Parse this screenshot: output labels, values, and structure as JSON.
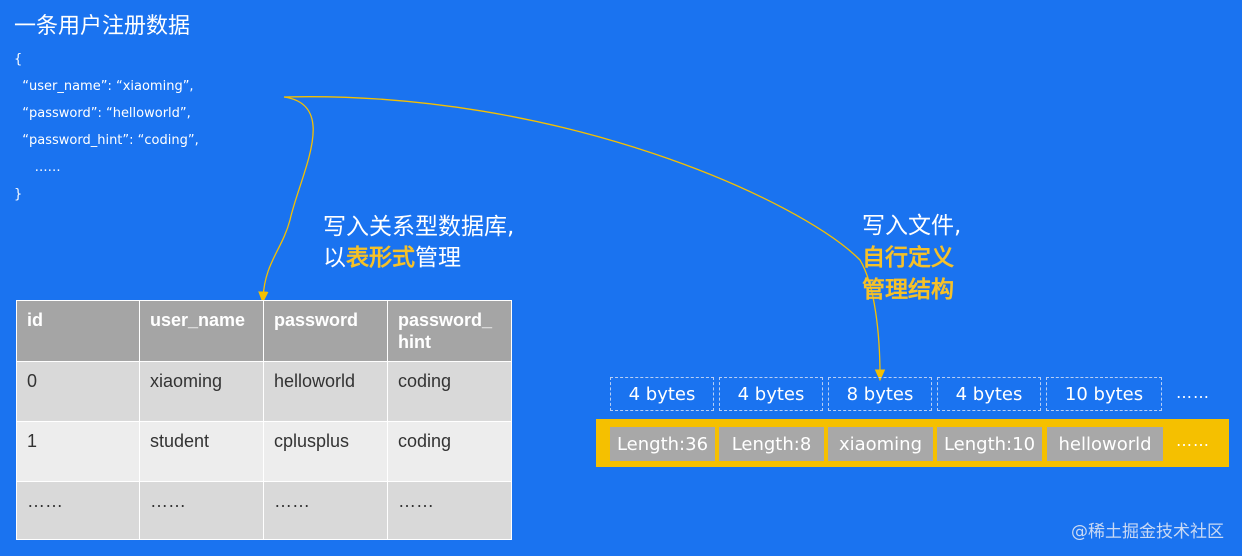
{
  "title": "一条用户注册数据",
  "json_lines": [
    "{",
    "  “user_name”: “xiaoming”,",
    "  “password”: “helloworld”,",
    "  “password_hint”: “coding”,",
    "     ……",
    "}"
  ],
  "label_db": {
    "line1": "写入关系型数据库,",
    "prefix": "以",
    "highlight": "表形式",
    "suffix": "管理"
  },
  "label_file": {
    "line1": "写入文件,",
    "highlight1": "自行定义",
    "highlight2": "管理结构"
  },
  "table": {
    "headers": [
      "id",
      "user_name",
      "password",
      "password_ hint"
    ],
    "rows": [
      [
        "0",
        "xiaoming",
        "helloworld",
        "coding"
      ],
      [
        "1",
        "student",
        "cplusplus",
        "coding"
      ],
      [
        "……",
        "……",
        "……",
        "……"
      ]
    ]
  },
  "byte_sizes": [
    "4 bytes",
    "4 bytes",
    "8 bytes",
    "4 bytes",
    "10 bytes"
  ],
  "byte_more": "……",
  "file_cells": [
    "Length:36",
    "Length:8",
    "xiaoming",
    "Length:10",
    "helloworld"
  ],
  "file_more": "……",
  "watermark": "@稀土掘金技术社区",
  "colors": {
    "background": "#1a73f0",
    "highlight": "#f6c128",
    "arrow": "#f5c000",
    "header": "#a5a5a5"
  }
}
